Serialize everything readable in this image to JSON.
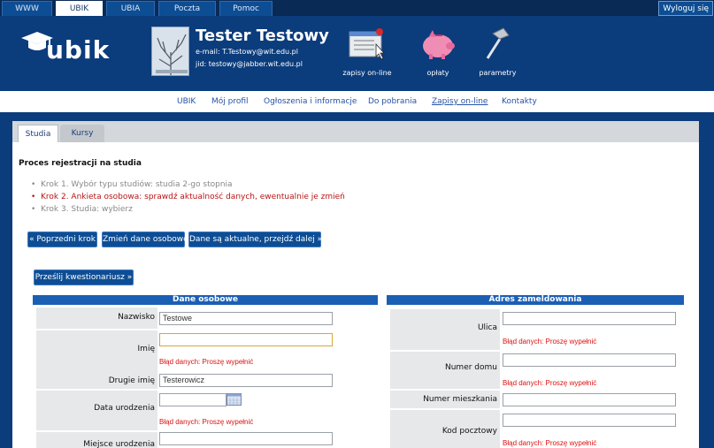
{
  "topnav": {
    "tabs": [
      "WWW",
      "UBIK",
      "UBIA",
      "Poczta",
      "Pomoc"
    ],
    "logout": "Wyloguj się"
  },
  "header": {
    "logo": "ubik",
    "user_name": "Tester Testowy",
    "email": "e-mail: T.Testowy@wit.edu.pl",
    "jid": "jid: testowy@jabber.wit.edu.pl",
    "icons": [
      "zapisy on-line",
      "opłaty",
      "parametry"
    ]
  },
  "mainnav": [
    "UBIK",
    "Mój profil",
    "Ogłoszenia i informacje",
    "Do pobrania",
    "Zapisy on-line",
    "Kontakty"
  ],
  "content_tabs": [
    "Studia",
    "Kursy"
  ],
  "section_title": "Proces rejestracji na studia",
  "steps": [
    "Krok 1. Wybór typu studiów: studia 2-go stopnia",
    "Krok 2. Ankieta osobowa: sprawdź aktualność danych, ewentualnie je zmień",
    "Krok 3. Studia: wybierz"
  ],
  "buttons": {
    "prev": "« Poprzedni krok",
    "change": "Zmień dane osobowe",
    "next": "Dane są aktualne, przejdź dalej »",
    "send": "Prześlij kwestionariusz »"
  },
  "personal": {
    "header": "Dane osobowe",
    "labels": [
      "Nazwisko",
      "Imię",
      "Drugie imię",
      "Data urodzenia",
      "Miejsce urodzenia"
    ],
    "values": [
      "Testowe",
      "",
      "Testerowicz",
      "",
      ""
    ]
  },
  "address": {
    "header": "Adres zameldowania",
    "labels": [
      "Ulica",
      "Numer domu",
      "Numer mieszkania",
      "Kod pocztowy"
    ]
  },
  "error_text": "Błąd danych: Proszę wypełnić",
  "colors": {
    "brand": "#0b3c7c",
    "accent": "#1b5fb5",
    "error": "#d11111"
  }
}
